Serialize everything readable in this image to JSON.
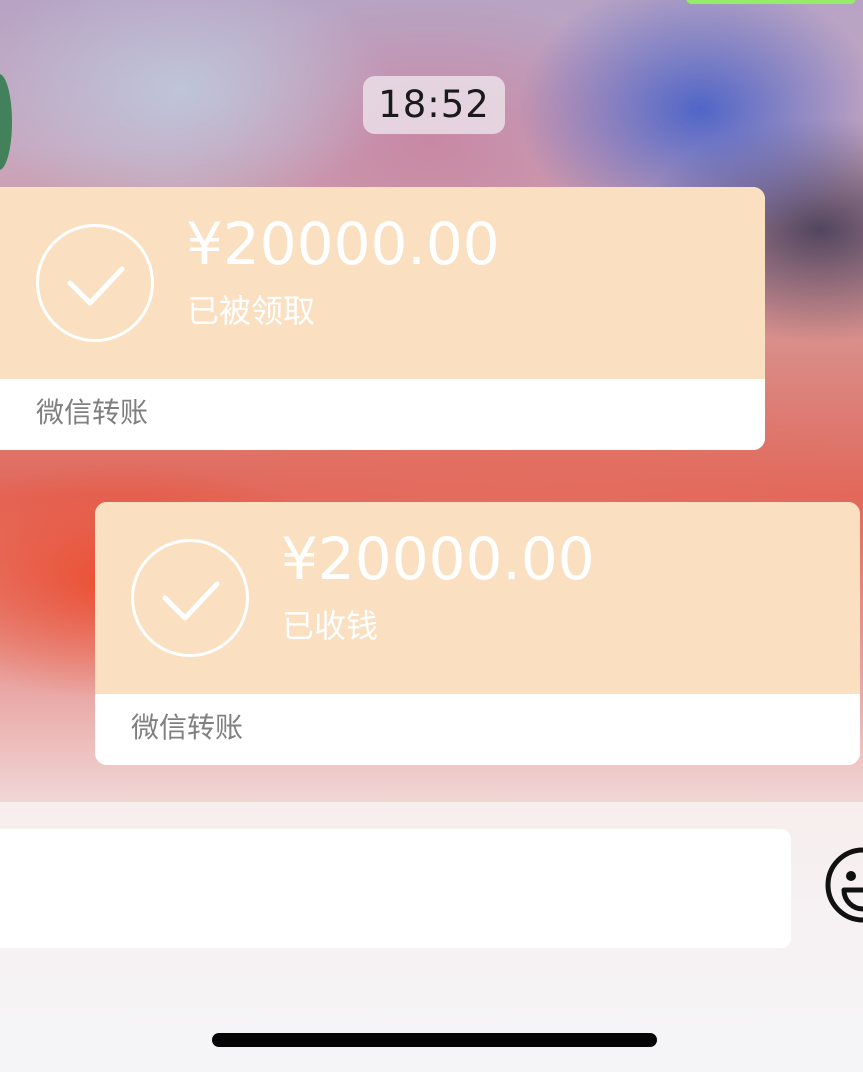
{
  "colors": {
    "transfer_card_top": "#fae0c1",
    "transfer_card_text": "#ffffff",
    "transfer_card_source_text": "#808080",
    "timestamp_bg": "#e8dce4",
    "input_bar_bg": "#f5f5f7",
    "home_indicator": "#050505"
  },
  "chat": {
    "timestamp": "18:52",
    "messages": [
      {
        "type": "transfer",
        "amount": "¥20000.00",
        "status": "已被领取",
        "source": "微信转账",
        "icon": "check-circle-icon"
      },
      {
        "type": "transfer",
        "amount": "¥20000.00",
        "status": "已收钱",
        "source": "微信转账",
        "icon": "check-circle-icon"
      }
    ]
  },
  "input_bar": {
    "text_value": "",
    "emoji_icon": "emoji-face-icon"
  }
}
